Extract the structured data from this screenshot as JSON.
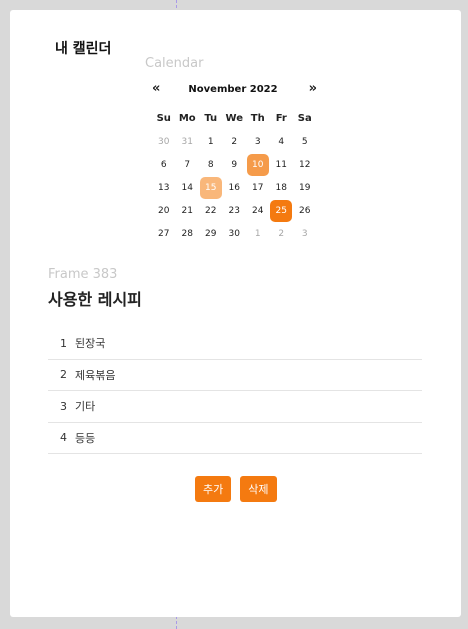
{
  "app": {
    "title": "내 캘린더"
  },
  "calendar": {
    "label": "Calendar",
    "prev_label": "«",
    "next_label": "»",
    "month_label": "November 2022",
    "weekdays": [
      "Su",
      "Mo",
      "Tu",
      "We",
      "Th",
      "Fr",
      "Sa"
    ],
    "weeks": [
      [
        {
          "d": "30",
          "muted": true
        },
        {
          "d": "31",
          "muted": true
        },
        {
          "d": "1"
        },
        {
          "d": "2"
        },
        {
          "d": "3"
        },
        {
          "d": "4"
        },
        {
          "d": "5"
        }
      ],
      [
        {
          "d": "6"
        },
        {
          "d": "7"
        },
        {
          "d": "8"
        },
        {
          "d": "9"
        },
        {
          "d": "10",
          "highlight": "s1"
        },
        {
          "d": "11"
        },
        {
          "d": "12"
        }
      ],
      [
        {
          "d": "13"
        },
        {
          "d": "14"
        },
        {
          "d": "15",
          "highlight": "s2"
        },
        {
          "d": "16"
        },
        {
          "d": "17"
        },
        {
          "d": "18"
        },
        {
          "d": "19"
        }
      ],
      [
        {
          "d": "20"
        },
        {
          "d": "21"
        },
        {
          "d": "22"
        },
        {
          "d": "23"
        },
        {
          "d": "24"
        },
        {
          "d": "25",
          "highlight": "s3"
        },
        {
          "d": "26"
        }
      ],
      [
        {
          "d": "27"
        },
        {
          "d": "28"
        },
        {
          "d": "29"
        },
        {
          "d": "30"
        },
        {
          "d": "1",
          "muted": true
        },
        {
          "d": "2",
          "muted": true
        },
        {
          "d": "3",
          "muted": true
        }
      ]
    ],
    "colors": {
      "accent": "#f47a10",
      "highlight_mid": "#f59b4a",
      "highlight_light": "#f9b77a"
    }
  },
  "recipes": {
    "frame_label": "Frame 383",
    "title": "사용한 레시피",
    "items": [
      {
        "num": "1",
        "name": "된장국"
      },
      {
        "num": "2",
        "name": "제육볶음"
      },
      {
        "num": "3",
        "name": "기타"
      },
      {
        "num": "4",
        "name": "등등"
      }
    ]
  },
  "actions": {
    "add_label": "추가",
    "delete_label": "삭제"
  }
}
